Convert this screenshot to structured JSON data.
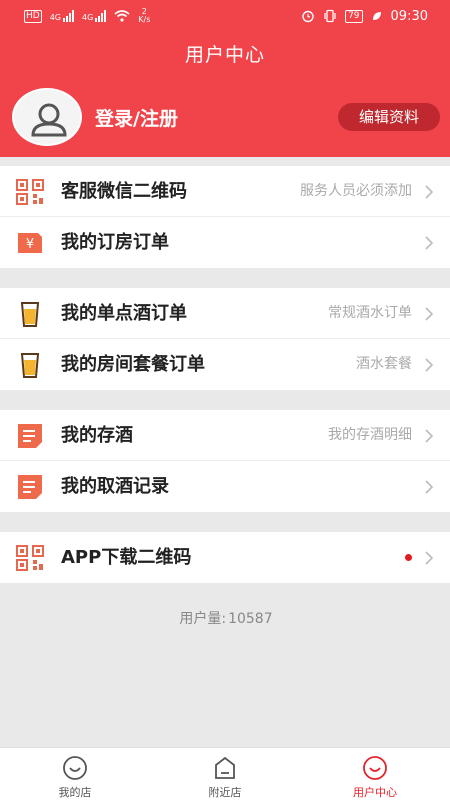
{
  "status_bar": {
    "hd": "HD",
    "net1": "4G",
    "net2": "4G",
    "speed_value": "2",
    "speed_unit": "K/s",
    "battery": "79",
    "time": "09:30"
  },
  "header": {
    "title": "用户中心",
    "login_label": "登录/注册",
    "edit_label": "编辑资料"
  },
  "menu_groups": [
    {
      "items": [
        {
          "label": "客服微信二维码",
          "subtitle": "服务人员必须添加",
          "icon": "qr-code-icon"
        },
        {
          "label": "我的订房订单",
          "subtitle": "",
          "icon": "yen-tag-icon"
        }
      ]
    },
    {
      "items": [
        {
          "label": "我的单点酒订单",
          "subtitle": "常规酒水订单",
          "icon": "beer-glass-icon"
        },
        {
          "label": "我的房间套餐订单",
          "subtitle": "酒水套餐",
          "icon": "beer-glass-icon"
        }
      ]
    },
    {
      "items": [
        {
          "label": "我的存酒",
          "subtitle": "我的存酒明细",
          "icon": "note-icon"
        },
        {
          "label": "我的取酒记录",
          "subtitle": "",
          "icon": "note-icon"
        }
      ]
    },
    {
      "items": [
        {
          "label": "APP下载二维码",
          "subtitle": "",
          "icon": "qr-code-icon",
          "has_dot": true
        }
      ]
    }
  ],
  "footer": {
    "user_count_label": "用户量:",
    "user_count_value": "10587"
  },
  "tabbar": {
    "tabs": [
      {
        "label": "我的店",
        "icon": "smile-icon",
        "active": false
      },
      {
        "label": "附近店",
        "icon": "shop-icon",
        "active": false
      },
      {
        "label": "用户中心",
        "icon": "smile-icon",
        "active": true
      }
    ]
  },
  "colors": {
    "brand_red": "#f0434a",
    "active_tab": "#e2242d"
  }
}
